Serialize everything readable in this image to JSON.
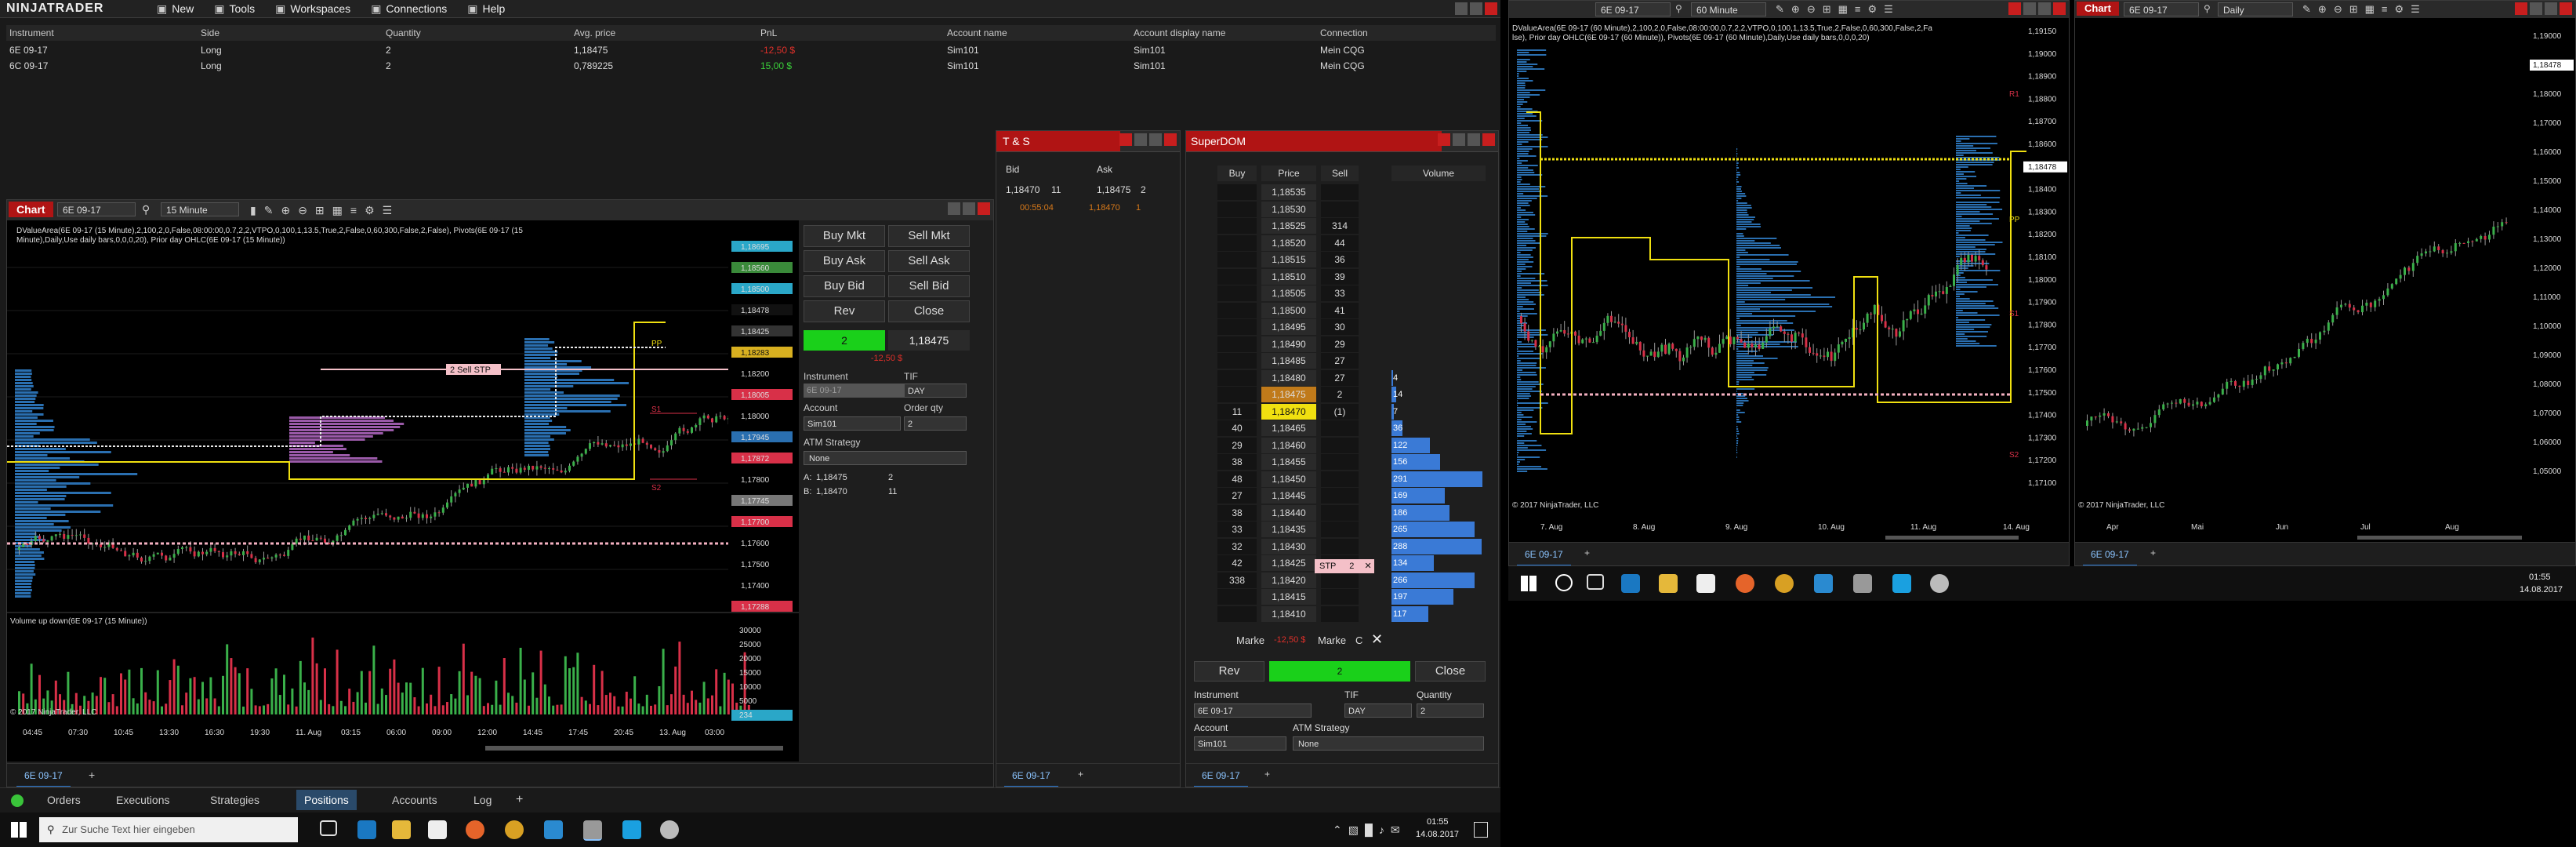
{
  "menu": {
    "logo": "NINJATRADER",
    "items": [
      {
        "label": "New",
        "icon": "new-icon"
      },
      {
        "label": "Tools",
        "icon": "tools-icon"
      },
      {
        "label": "Workspaces",
        "icon": "workspaces-icon"
      },
      {
        "label": "Connections",
        "icon": "connections-icon"
      },
      {
        "label": "Help",
        "icon": "help-icon"
      }
    ]
  },
  "positions": {
    "headers": [
      "Instrument",
      "Side",
      "Quantity",
      "Avg. price",
      "PnL",
      "Account name",
      "Account display name",
      "Connection"
    ],
    "rows": [
      {
        "instrument": "6E 09-17",
        "side": "Long",
        "quantity": "2",
        "avg_price": "1,18475",
        "pnl": "-12,50 $",
        "account": "Sim101",
        "display": "Sim101",
        "connection": "Mein CQG"
      },
      {
        "instrument": "6C 09-17",
        "side": "Long",
        "quantity": "2",
        "avg_price": "0,789225",
        "pnl": "15,00 $",
        "account": "Sim101",
        "display": "Sim101",
        "connection": "Mein CQG"
      }
    ]
  },
  "bottom_tabs": [
    "Orders",
    "Executions",
    "Strategies",
    "Positions",
    "Accounts",
    "Log"
  ],
  "chart1": {
    "tag": "Chart",
    "instrument": "6E 09-17",
    "interval": "15 Minute",
    "indicator_text": "DValueArea(6E 09-17 (15 Minute),2,100,2,0,False,08:00:00,0.7,2,2,VTPO,0,100,1,13.5,True,2,False,0,60,300,False,2,False), Pivots(6E 09-17 (15 Minute),Daily,Use daily bars,0,0,0,20), Prior day OHLC(6E 09-17 (15 Minute))",
    "volume_label": "Volume up down(6E 09-17 (15 Minute))",
    "copyright": "© 2017 NinjaTrader, LLC",
    "order_label": "2 Sell STP",
    "price_labels": [
      {
        "v": "1,18695",
        "c": "#2aa7c8"
      },
      {
        "v": "1,18560",
        "c": "#3a8a3a"
      },
      {
        "v": "1,18500",
        "c": "#2aa7c8"
      },
      {
        "v": "1,18478",
        "c": "#111"
      },
      {
        "v": "1,18425",
        "c": "#333"
      },
      {
        "v": "1,18283",
        "c": "#d8b020"
      },
      {
        "v": "1,18200",
        "c": ""
      },
      {
        "v": "1,18005",
        "c": "#d83048"
      },
      {
        "v": "1,18000",
        "c": ""
      },
      {
        "v": "1,17945",
        "c": "#2a6fb0"
      },
      {
        "v": "1,17872",
        "c": "#d83048"
      },
      {
        "v": "1,17800",
        "c": ""
      },
      {
        "v": "1,17745",
        "c": "#777"
      },
      {
        "v": "1,17700",
        "c": "#d83048"
      },
      {
        "v": "1,17600",
        "c": ""
      },
      {
        "v": "1,17500",
        "c": ""
      },
      {
        "v": "1,17400",
        "c": ""
      },
      {
        "v": "1,17288",
        "c": "#d83048"
      }
    ],
    "vol_axis": [
      "30000",
      "25000",
      "20000",
      "15000",
      "10000",
      "5000",
      "234"
    ],
    "time_axis": [
      "04:45",
      "07:30",
      "10:45",
      "13:30",
      "16:30",
      "19:30",
      "11. Aug",
      "03:15",
      "06:00",
      "09:00",
      "12:00",
      "14:45",
      "17:45",
      "20:45",
      "13. Aug",
      "03:00"
    ],
    "tab_label": "6E 09-17",
    "pivots": [
      "S1",
      "S2",
      "PP"
    ]
  },
  "chart_trader": {
    "buy_mkt": "Buy Mkt",
    "sell_mkt": "Sell Mkt",
    "buy_ask": "Buy Ask",
    "sell_ask": "Sell Ask",
    "buy_bid": "Buy Bid",
    "sell_bid": "Sell Bid",
    "rev": "Rev",
    "close": "Close",
    "position_qty": "2",
    "position_price": "1,18475",
    "position_pnl": "-12,50 $",
    "instrument_label": "Instrument",
    "instrument": "6E 09-17",
    "tif_label": "TIF",
    "tif": "DAY",
    "account_label": "Account",
    "account": "Sim101",
    "qty_label": "Order qty",
    "qty": "2",
    "atm_label": "ATM Strategy",
    "atm": "None",
    "ask_label": "A:",
    "ask": "1,18475",
    "ask_size": "2",
    "bid_label": "B:",
    "bid": "1,18470",
    "bid_size": "11"
  },
  "ts": {
    "title": "T & S",
    "bid_h": "Bid",
    "ask_h": "Ask",
    "bid": "1,18470",
    "bid_size": "11",
    "ask": "1,18475",
    "ask_size": "2",
    "time": "00:55:04",
    "trade_price": "1,18470",
    "trade_size": "1",
    "tab": "6E 09-17"
  },
  "superdom": {
    "title": "SuperDOM",
    "headers": [
      "Buy",
      "Price",
      "Sell",
      "Volume"
    ],
    "rows": [
      {
        "buy": "",
        "price": "1,18535",
        "sell": "",
        "vol": ""
      },
      {
        "buy": "",
        "price": "1,18530",
        "sell": "",
        "vol": ""
      },
      {
        "buy": "",
        "price": "1,18525",
        "sell": "314",
        "vol": ""
      },
      {
        "buy": "",
        "price": "1,18520",
        "sell": "44",
        "vol": ""
      },
      {
        "buy": "",
        "price": "1,18515",
        "sell": "36",
        "vol": ""
      },
      {
        "buy": "",
        "price": "1,18510",
        "sell": "39",
        "vol": ""
      },
      {
        "buy": "",
        "price": "1,18505",
        "sell": "33",
        "vol": ""
      },
      {
        "buy": "",
        "price": "1,18500",
        "sell": "41",
        "vol": ""
      },
      {
        "buy": "",
        "price": "1,18495",
        "sell": "30",
        "vol": ""
      },
      {
        "buy": "",
        "price": "1,18490",
        "sell": "29",
        "vol": ""
      },
      {
        "buy": "",
        "price": "1,18485",
        "sell": "27",
        "vol": ""
      },
      {
        "buy": "",
        "price": "1,18480",
        "sell": "27",
        "vol": "4"
      },
      {
        "buy": "",
        "price": "1,18475",
        "sell": "2",
        "vol": "14"
      },
      {
        "buy": "11",
        "price": "1,18470",
        "sell": "(1)",
        "vol": "7"
      },
      {
        "buy": "40",
        "price": "1,18465",
        "sell": "",
        "vol": "36"
      },
      {
        "buy": "29",
        "price": "1,18460",
        "sell": "",
        "vol": "122"
      },
      {
        "buy": "38",
        "price": "1,18455",
        "sell": "",
        "vol": "156"
      },
      {
        "buy": "48",
        "price": "1,18450",
        "sell": "",
        "vol": "291"
      },
      {
        "buy": "27",
        "price": "1,18445",
        "sell": "",
        "vol": "169"
      },
      {
        "buy": "38",
        "price": "1,18440",
        "sell": "",
        "vol": "186"
      },
      {
        "buy": "33",
        "price": "1,18435",
        "sell": "",
        "vol": "265"
      },
      {
        "buy": "32",
        "price": "1,18430",
        "sell": "",
        "vol": "288"
      },
      {
        "buy": "42",
        "price": "1,18425",
        "sell": "",
        "vol": "134"
      },
      {
        "buy": "338",
        "price": "1,18420",
        "sell": "",
        "vol": "266"
      },
      {
        "buy": "",
        "price": "1,18415",
        "sell": "",
        "vol": "197"
      },
      {
        "buy": "",
        "price": "1,18410",
        "sell": "",
        "vol": "117"
      }
    ],
    "stp_label": "STP",
    "stp_qty": "2",
    "market_l": "Marke",
    "pnl": "-12,50 $",
    "market_r": "Marke",
    "c_label": "C",
    "rev": "Rev",
    "qty": "2",
    "close": "Close",
    "instrument_label": "Instrument",
    "instrument": "6E 09-17",
    "tif_label": "TIF",
    "tif": "DAY",
    "quantity_label": "Quantity",
    "quantity": "2",
    "account_label": "Account",
    "account": "Sim101",
    "atm_label": "ATM Strategy",
    "atm": "None",
    "tab": "6E 09-17"
  },
  "chart2": {
    "instrument": "6E 09-17",
    "interval": "60 Minute",
    "indicator_text": "DValueArea(6E 09-17 (60 Minute),2,100,2,0,False,08:00:00,0.7,2,2,VTPO,0,100,1,13.5,True,2,False,0,60,300,False,2,False), Prior day OHLC(6E 09-17 (60 Minute)), Pivots(6E 09-17 (60 Minute),Daily,Use daily bars,0,0,0,20)",
    "copyright": "© 2017 NinjaTrader, LLC",
    "axis": [
      "1,19150",
      "1,19000",
      "1,18900",
      "1,18800",
      "1,18700",
      "1,18600",
      "1,18478",
      "1,18400",
      "1,18300",
      "1,18200",
      "1,18100",
      "1,18000",
      "1,17900",
      "1,17800",
      "1,17700",
      "1,17600",
      "1,17500",
      "1,17400",
      "1,17300",
      "1,17200",
      "1,17100"
    ],
    "time_axis": [
      "7. Aug",
      "8. Aug",
      "9. Aug",
      "10. Aug",
      "11. Aug",
      "14. Aug"
    ],
    "tab": "6E 09-17",
    "pivots": [
      "R1",
      "PP",
      "S1",
      "S2"
    ]
  },
  "chart3": {
    "tag": "Chart",
    "instrument": "6E 09-17",
    "interval": "Daily",
    "copyright": "© 2017 NinjaTrader, LLC",
    "axis": [
      "1,19000",
      "1,18478",
      "1,18000",
      "1,17000",
      "1,16000",
      "1,15000",
      "1,14000",
      "1,13000",
      "1,12000",
      "1,11000",
      "1,10000",
      "1,09000",
      "1,08000",
      "1,07000",
      "1,06000",
      "1,05000"
    ],
    "time_axis": [
      "Apr",
      "Mai",
      "Jun",
      "Jul",
      "Aug"
    ],
    "tab": "6E 09-17"
  },
  "taskbar_left": {
    "search_placeholder": "Zur Suche Text hier eingeben",
    "time": "01:55",
    "date": "14.08.2017"
  },
  "taskbar_right": {
    "time": "01:55",
    "date": "14.08.2017"
  },
  "colors": {
    "accent": "#b01414",
    "buy": "#2a7ad6",
    "green": "#1ad01a",
    "sell": "#d83048"
  }
}
